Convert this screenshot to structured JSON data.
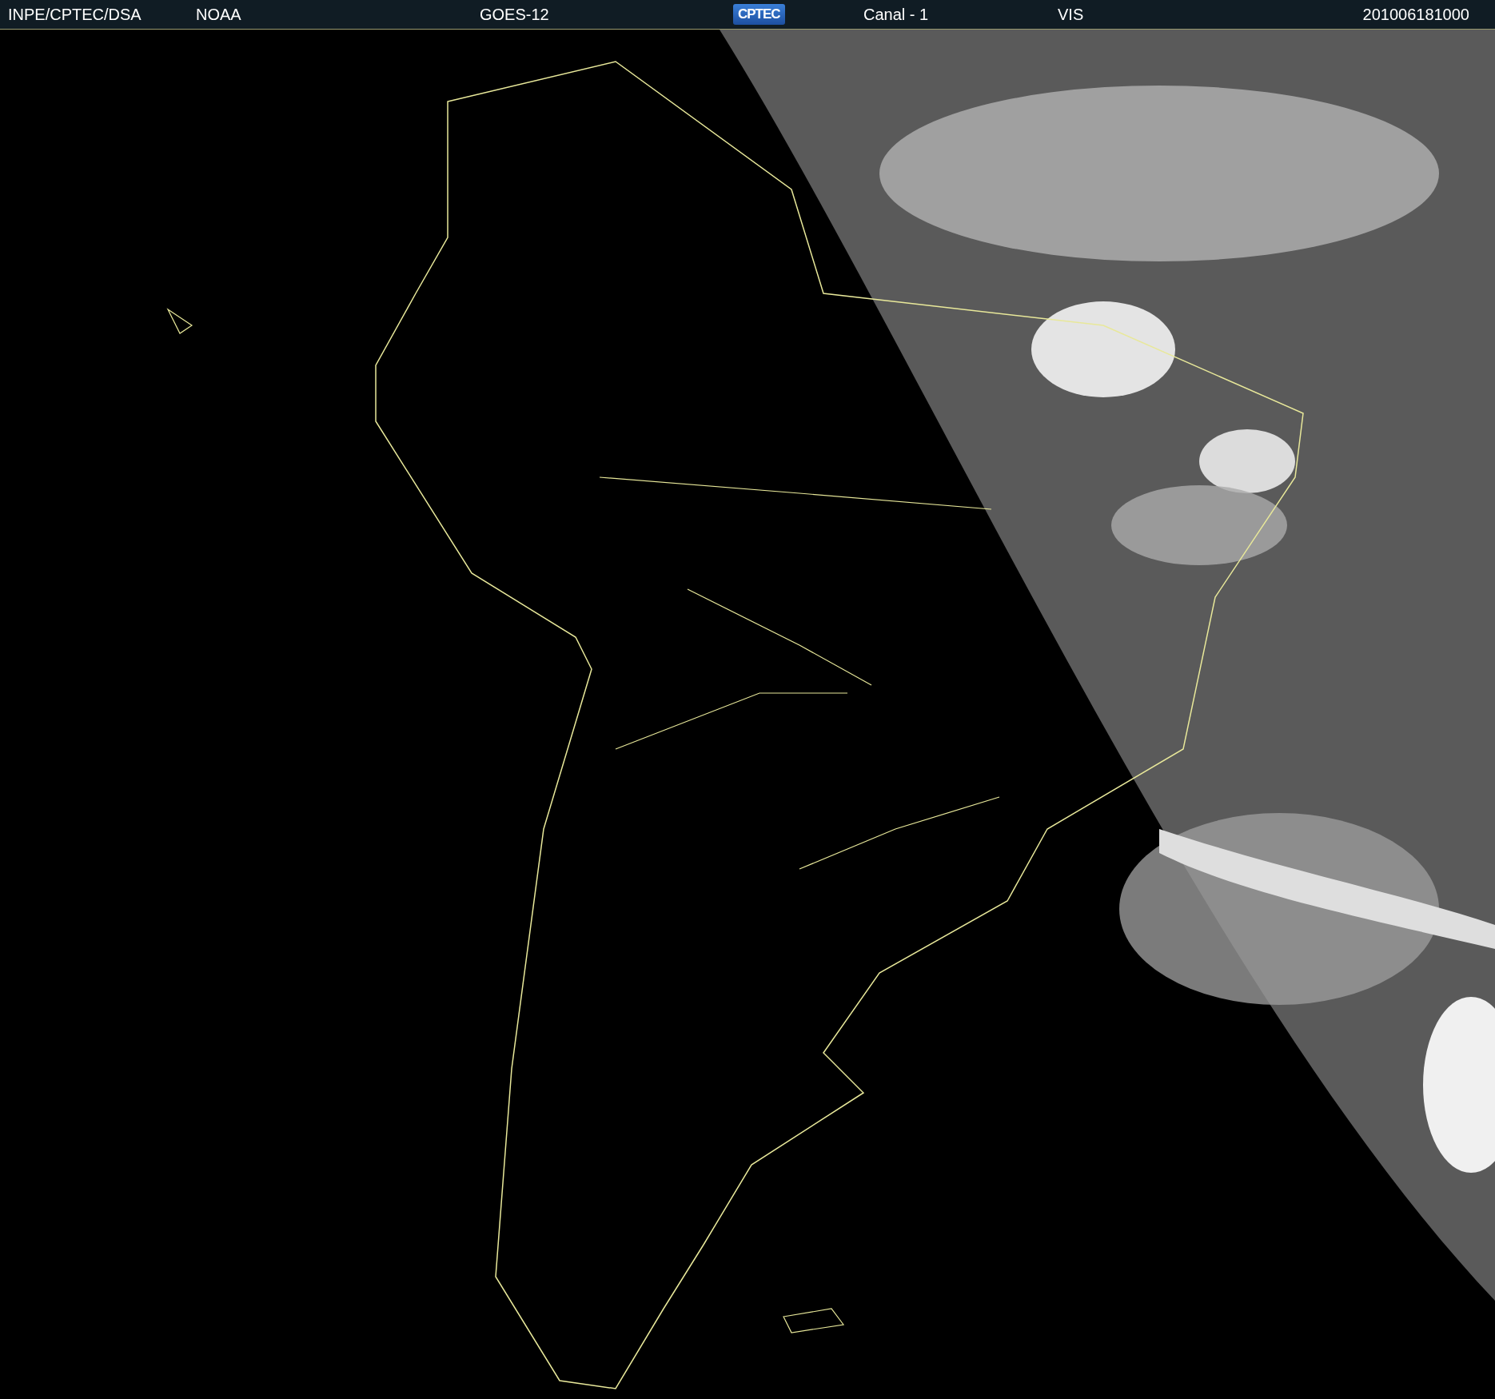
{
  "header": {
    "items": [
      "INPE/CPTEC/DSA",
      "NOAA",
      "GOES-12"
    ],
    "logo": "CPTEC",
    "channel": "Canal - 1",
    "band": "VIS",
    "timestamp": "201006181000"
  }
}
